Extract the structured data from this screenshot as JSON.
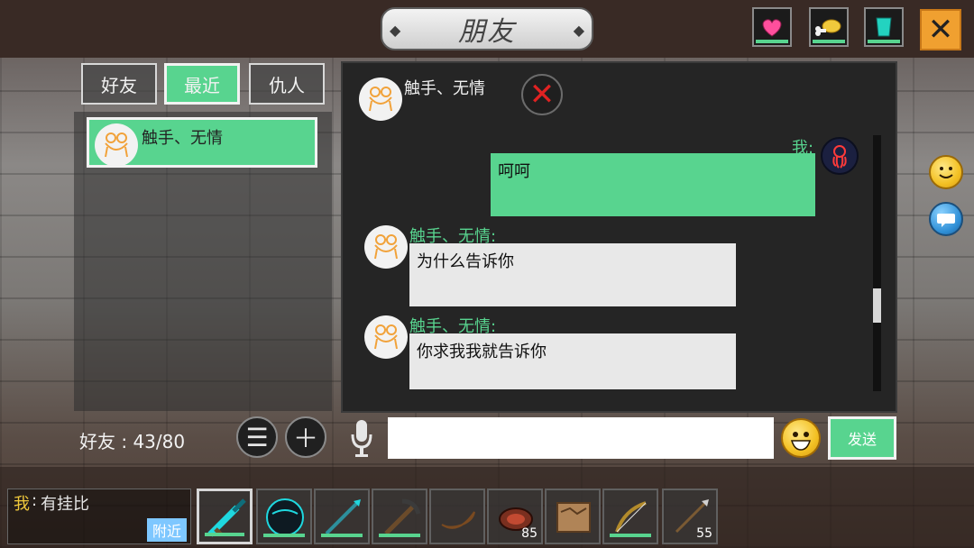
{
  "header": {
    "title": "朋友",
    "stats": [
      {
        "icon": "heart-icon",
        "color": "#ff4f9d"
      },
      {
        "icon": "meat-icon",
        "color": "#f0c93c"
      },
      {
        "icon": "cup-icon",
        "color": "#23d3c0"
      }
    ],
    "close_icon": "close-icon"
  },
  "tabs": [
    {
      "label": "好友",
      "active": false
    },
    {
      "label": "最近",
      "active": true
    },
    {
      "label": "仇人",
      "active": false
    }
  ],
  "friends_list": [
    {
      "name": "触手、无情"
    }
  ],
  "chat": {
    "header_name": "触手、无情",
    "remove_icon": "remove-friend-icon",
    "messages": [
      {
        "sender": "我:",
        "text": "呵呵",
        "mine": true
      },
      {
        "sender": "触手、无情:",
        "text": "为什么告诉你",
        "mine": false
      },
      {
        "sender": "触手、无情:",
        "text": "你求我我就告诉你",
        "mine": false
      }
    ],
    "scroll_position": 0.8
  },
  "footer": {
    "friends_count": "好友 : 43/80",
    "list_icon": "list-icon",
    "add_icon": "add-icon",
    "mic_icon": "microphone-icon",
    "input_placeholder": "",
    "emoji_icon": "emoji-icon",
    "send_label": "发送"
  },
  "side_icons": [
    {
      "icon": "smile-icon"
    },
    {
      "icon": "chat-bubble-icon"
    }
  ],
  "bottom_chat": {
    "me_label": "我",
    "separator": ":",
    "message": "有挂比",
    "tag": "附近"
  },
  "hotbar": [
    {
      "item": "diamond-sword-icon",
      "count": ""
    },
    {
      "item": "dark-orb-icon",
      "count": ""
    },
    {
      "item": "spear-icon",
      "count": ""
    },
    {
      "item": "pickaxe-icon",
      "count": ""
    },
    {
      "item": "banana-icon",
      "count": ""
    },
    {
      "item": "steak-icon",
      "count": "85"
    },
    {
      "item": "map-icon",
      "count": ""
    },
    {
      "item": "bow-icon",
      "count": ""
    },
    {
      "item": "arrow-icon",
      "count": "55"
    }
  ]
}
